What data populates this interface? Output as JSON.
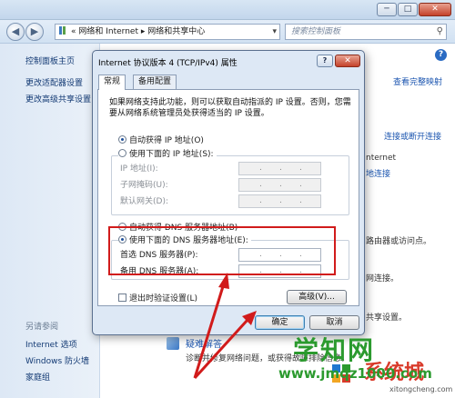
{
  "explorer": {
    "window_controls": {
      "minimize": "─",
      "maximize": "□",
      "close": "✕"
    },
    "address": {
      "prefix": "«",
      "path": "网络和 Internet ▸ 网络和共享中心",
      "dropdown": "▾"
    },
    "search_placeholder": "搜索控制面板",
    "sidebar": {
      "home": "控制面板主页",
      "change_adapter": "更改适配器设置",
      "change_sharing": "更改高级共享设置",
      "see_also": "另请参阅",
      "internet_options": "Internet 选项",
      "firewall": "Windows 防火墙",
      "homegroup": "家庭组"
    },
    "main": {
      "view_map": "查看完整映射",
      "connect_disconnect": "连接或断开连接",
      "internet": "nternet",
      "conn_link": "地连接",
      "router_text": "路由器或访问点。",
      "conn_text": "网连接。",
      "sharing_text": "共享设置。",
      "troubleshoot": "疑难解答",
      "troubleshoot_desc": "诊断并修复网络问题，或获得故障排除信息。"
    }
  },
  "dialog": {
    "title": "Internet 协议版本 4 (TCP/IPv4) 属性",
    "help_btn": "?",
    "close_btn": "✕",
    "tabs": [
      "常规",
      "备用配置"
    ],
    "description": "如果网络支持此功能，则可以获取自动指派的 IP 设置。否则，您需要从网络系统管理员处获得适当的 IP 设置。",
    "ip": {
      "auto": "自动获得 IP 地址(O)",
      "manual": "使用下面的 IP 地址(S):",
      "address": "IP 地址(I):",
      "subnet": "子网掩码(U):",
      "gateway": "默认网关(D):"
    },
    "dns": {
      "auto": "自动获得 DNS 服务器地址(B)",
      "manual": "使用下面的 DNS 服务器地址(E):",
      "preferred": "首选 DNS 服务器(P):",
      "alternate": "备用 DNS 服务器(A):"
    },
    "validate_on_exit": "退出时验证设置(L)",
    "advanced_btn": "高级(V)...",
    "ok_btn": "确定",
    "cancel_btn": "取消",
    "ip_dot": "."
  },
  "watermark": {
    "main": "学知网",
    "url": "www.jmqz1000.com",
    "brand": "系统城",
    "small": "xitongcheng.com"
  },
  "colors": {
    "highlight": "#d11b1b",
    "watermark_green": "#2b9a2e"
  }
}
